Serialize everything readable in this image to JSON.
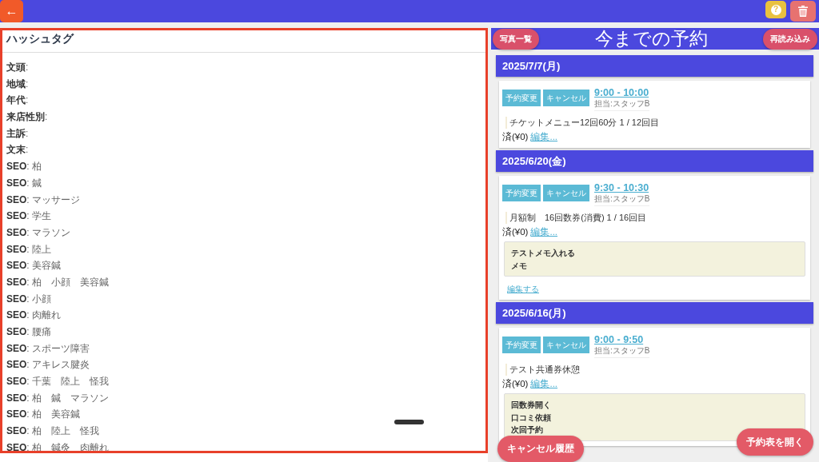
{
  "top_bar": {
    "back_button": "←",
    "help_button": "?"
  },
  "hashtags": {
    "title": "ハッシュタグ",
    "rows": [
      "**文頭**:",
      "**地域**:",
      "**年代**:",
      "**来店性別**:",
      "**主訴**:",
      "**文末**:",
      "**SEO**: 柏",
      "**SEO**: 鍼",
      "**SEO**: マッサージ",
      "**SEO**: 学生",
      "**SEO**: マラソン",
      "**SEO**: 陸上",
      "**SEO**: 美容鍼",
      "**SEO**: 柏　小顔　美容鍼",
      "**SEO**: 小顔",
      "**SEO**: 肉離れ",
      "**SEO**: 腰痛",
      "**SEO**: スポーツ障害",
      "**SEO**: アキレス腱炎",
      "**SEO**: 千葉　陸上　怪我",
      "**SEO**: 柏　鍼　マラソン",
      "**SEO**: 柏　美容鍼",
      "**SEO**: 柏　陸上　怪我",
      "**SEO**: 柏　鍼灸　肉離れ"
    ]
  },
  "history": {
    "title": "今までの予約",
    "photos_button": "写真一覧",
    "reload_button": "再読み込み",
    "reservations": [
      {
        "date": "2025/7/7(月)",
        "change_button": "予約変更",
        "cancel_button": "キャンセル",
        "time": "9:00 - 10:00",
        "staff": "担当:スタッフB",
        "menu": "チケットメニュー12回60分 1 / 12回目",
        "status": "済(¥0)",
        "edit_link": "編集..."
      },
      {
        "date": "2025/6/20(金)",
        "change_button": "予約変更",
        "cancel_button": "キャンセル",
        "time": "9:30 - 10:30",
        "staff": "担当:スタッフB",
        "menu": "月額制　16回数券(消費) 1 / 16回目",
        "status": "済(¥0)",
        "edit_link": "編集...",
        "memo": [
          "テストメモ入れる",
          "メモ"
        ],
        "memo_edit": "編集する"
      },
      {
        "date": "2025/6/16(月)",
        "change_button": "予約変更",
        "cancel_button": "キャンセル",
        "time": "9:00 - 9:50",
        "staff": "担当:スタッフB",
        "menu": "テスト共通券休憩",
        "status": "済(¥0)",
        "edit_link": "編集...",
        "memo": [
          "回数券開く",
          "口コミ依頼",
          "次回予約"
        ]
      }
    ],
    "cancel_history_button": "キャンセル履歴",
    "open_schedule_button": "予約表を開く"
  }
}
